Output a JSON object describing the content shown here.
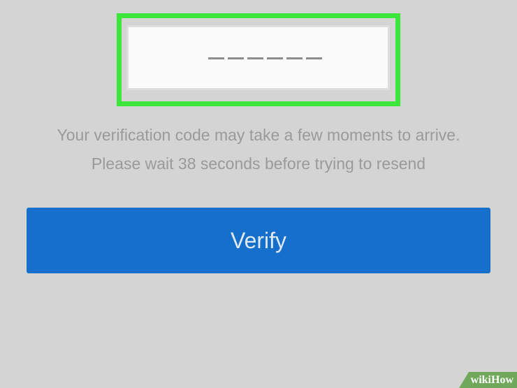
{
  "verification": {
    "code_length": 6,
    "code_value": "",
    "message_line_1": "Your verification code may take a few moments to arrive.",
    "message_line_2": "Please wait 38 seconds before trying to resend"
  },
  "actions": {
    "verify_label": "Verify"
  },
  "watermark": {
    "wiki": "wiki",
    "how": "How"
  },
  "colors": {
    "background": "#d4d4d4",
    "highlight": "#3de63a",
    "button": "#1670cb",
    "text_muted": "#9a9a9a"
  }
}
